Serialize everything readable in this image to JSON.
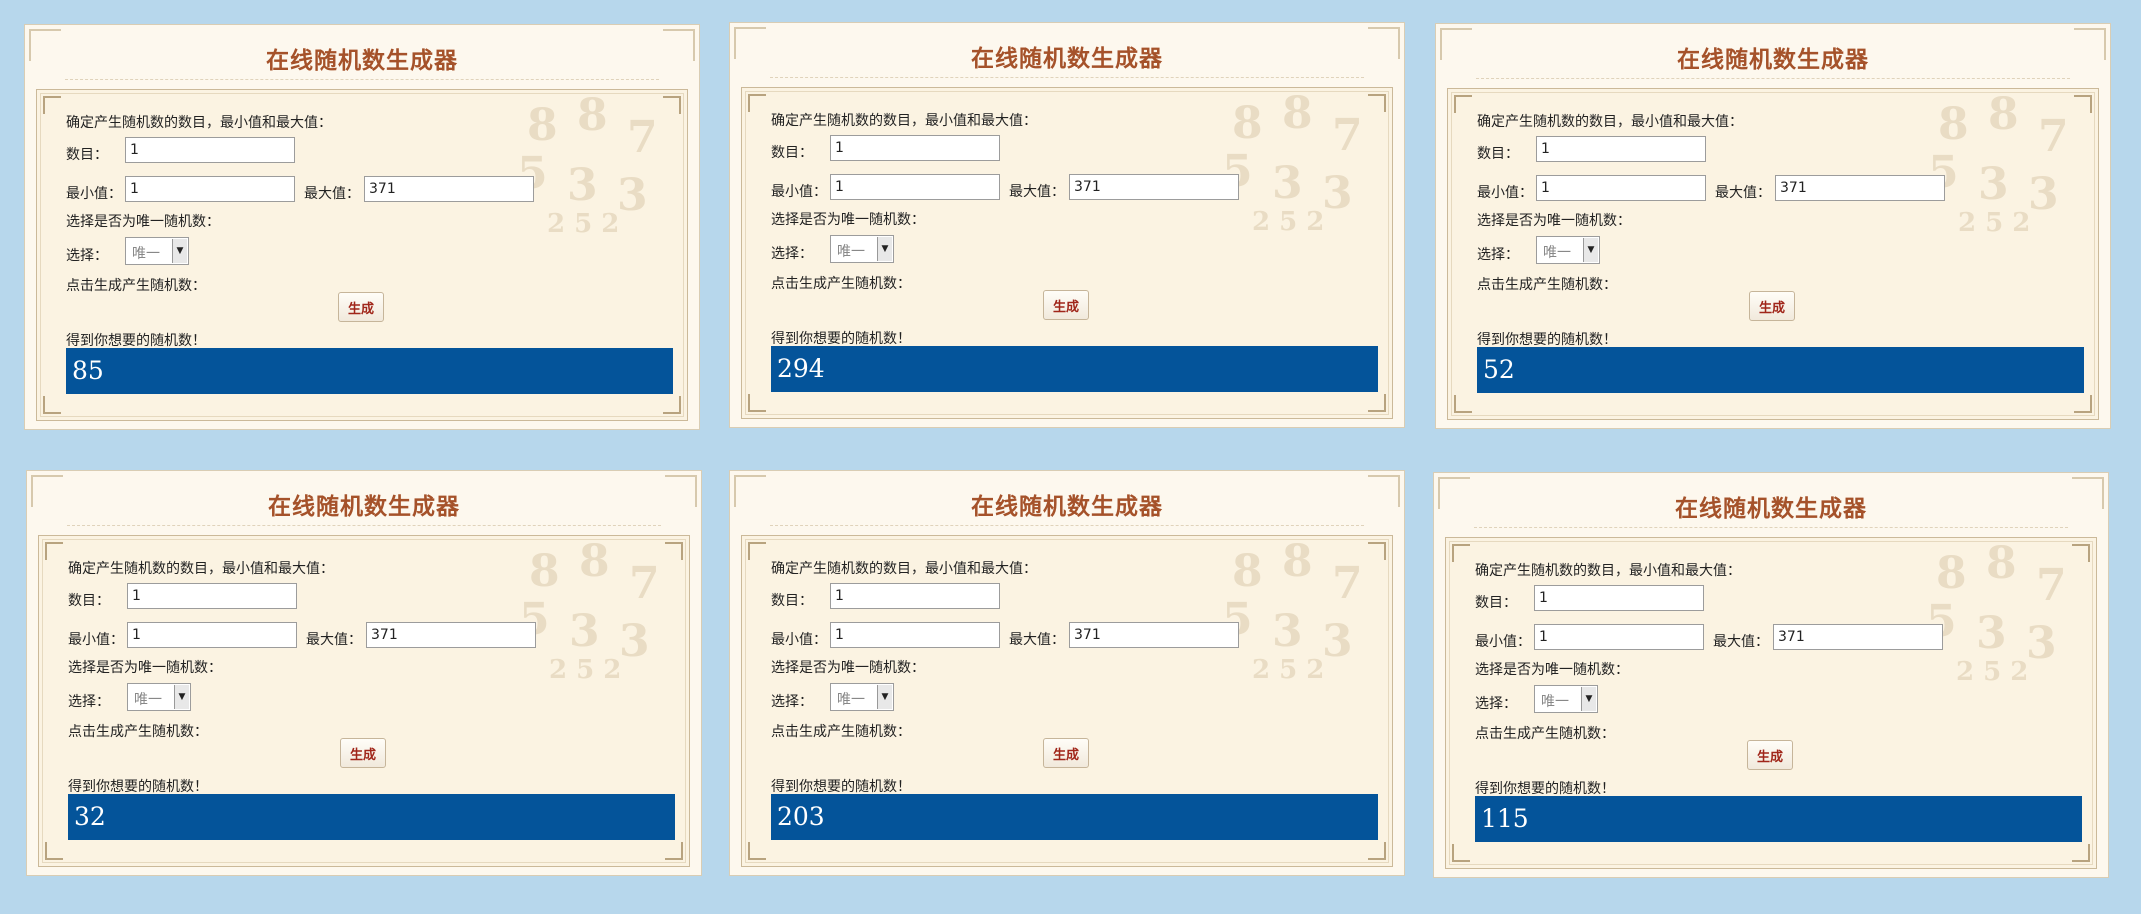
{
  "app": {
    "title": "在线随机数生成器",
    "prompt_label": "确定产生随机数的数目，最小值和最大值：",
    "count_label": "数目：",
    "min_label": "最小值：",
    "max_label": "最大值：",
    "unique_prompt": "选择是否为唯一随机数：",
    "select_label": "选择：",
    "click_prompt": "点击生成产生随机数：",
    "generate_button": "生成",
    "result_prompt": "得到你想要的随机数！"
  },
  "panels": [
    {
      "count": "1",
      "min": "1",
      "max": "371",
      "unique": "唯一",
      "result": "85"
    },
    {
      "count": "1",
      "min": "1",
      "max": "371",
      "unique": "唯一",
      "result": "294"
    },
    {
      "count": "1",
      "min": "1",
      "max": "371",
      "unique": "唯一",
      "result": "52"
    },
    {
      "count": "1",
      "min": "1",
      "max": "371",
      "unique": "唯一",
      "result": "32"
    },
    {
      "count": "1",
      "min": "1",
      "max": "371",
      "unique": "唯一",
      "result": "203"
    },
    {
      "count": "1",
      "min": "1",
      "max": "371",
      "unique": "唯一",
      "result": "115"
    }
  ],
  "colors": {
    "page_bg": "#b7d7ec",
    "panel_bg": "#fdf8ee",
    "title": "#a5522a",
    "result_bg": "#04549a",
    "button_text": "#a0261a"
  }
}
